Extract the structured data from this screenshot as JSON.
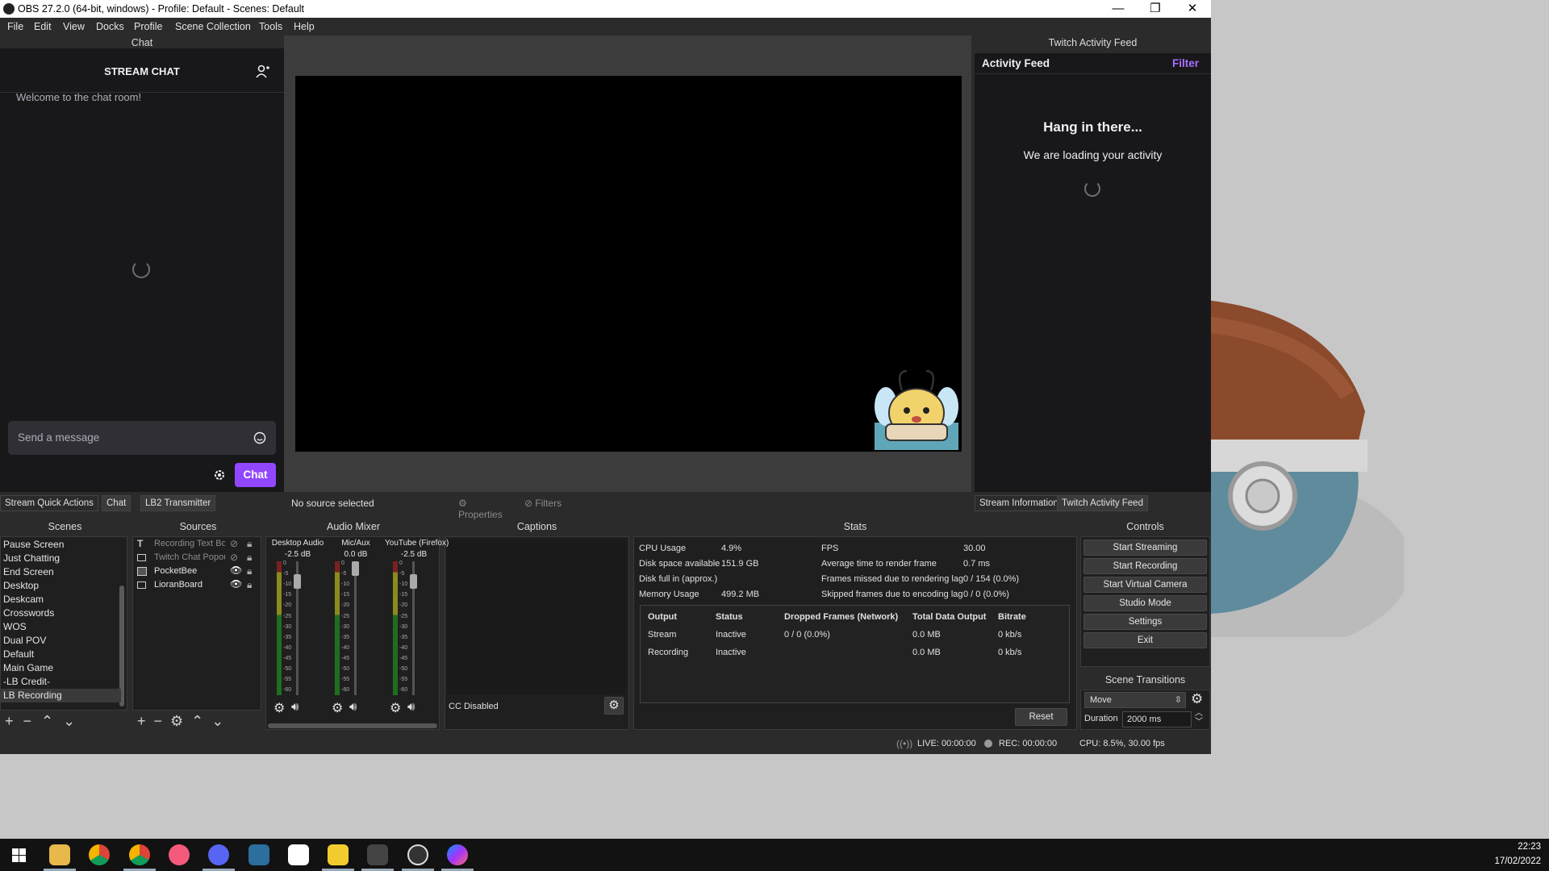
{
  "window": {
    "title": "OBS 27.2.0 (64-bit, windows) - Profile: Default - Scenes: Default",
    "min": "—",
    "max": "❐",
    "close": "✕"
  },
  "menu": [
    "File",
    "Edit",
    "View",
    "Docks",
    "Profile",
    "Scene Collection",
    "Tools",
    "Help"
  ],
  "chat": {
    "dock_title": "Chat",
    "header": "STREAM CHAT",
    "welcome": "Welcome to the chat room!",
    "placeholder": "Send a message",
    "button": "Chat"
  },
  "activity": {
    "dock_title": "Twitch Activity Feed",
    "header": "Activity Feed",
    "filter": "Filter",
    "loading_title": "Hang in there...",
    "loading_sub": "We are loading your activity"
  },
  "tabs_left": [
    "Stream Quick Actions",
    "Chat",
    "LB2 Transmitter"
  ],
  "tabs_right": [
    "Stream Information",
    "Twitch Activity Feed"
  ],
  "source_bar": {
    "status": "No source selected",
    "properties": "Properties",
    "filters": "Filters"
  },
  "scenes": {
    "title": "Scenes",
    "items": [
      "Pause Screen",
      "Just Chatting",
      "End Screen",
      "Desktop",
      "Deskcam",
      "Crosswords",
      "WOS",
      "Dual POV",
      "Default",
      "Main Game",
      "-LB Credit-",
      "LB Recording"
    ],
    "selected": "LB Recording"
  },
  "sources": {
    "title": "Sources",
    "items": [
      "Recording Text Bo",
      "Twitch Chat Popou",
      "PocketBee",
      "LioranBoard"
    ]
  },
  "mixer": {
    "title": "Audio Mixer",
    "channels": [
      {
        "name": "Desktop Audio",
        "db": "-2.5 dB"
      },
      {
        "name": "Mic/Aux",
        "db": "0.0 dB"
      },
      {
        "name": "YouTube (Firefox)",
        "db": "-2.5 dB"
      }
    ],
    "scale": [
      "0",
      "-5",
      "-10",
      "-15",
      "-20",
      "-25",
      "-30",
      "-35",
      "-40",
      "-45",
      "-50",
      "-55",
      "-60"
    ]
  },
  "captions": {
    "title": "Captions",
    "status": "CC Disabled"
  },
  "stats": {
    "title": "Stats",
    "left": [
      [
        "CPU Usage",
        "4.9%"
      ],
      [
        "Disk space available",
        "151.9 GB"
      ],
      [
        "Disk full in (approx.)",
        ""
      ],
      [
        "Memory Usage",
        "499.2 MB"
      ]
    ],
    "right": [
      [
        "FPS",
        "30.00"
      ],
      [
        "Average time to render frame",
        "0.7 ms"
      ],
      [
        "Frames missed due to rendering lag",
        "0 / 154 (0.0%)"
      ],
      [
        "Skipped frames due to encoding lag",
        "0 / 0 (0.0%)"
      ]
    ],
    "table_headers": [
      "Output",
      "Status",
      "Dropped Frames (Network)",
      "Total Data Output",
      "Bitrate"
    ],
    "rows": [
      [
        "Stream",
        "Inactive",
        "0 / 0 (0.0%)",
        "0.0 MB",
        "0 kb/s"
      ],
      [
        "Recording",
        "Inactive",
        "",
        "0.0 MB",
        "0 kb/s"
      ]
    ],
    "reset": "Reset"
  },
  "controls": {
    "title": "Controls",
    "buttons": [
      "Start Streaming",
      "Start Recording",
      "Start Virtual Camera",
      "Studio Mode",
      "Settings",
      "Exit"
    ]
  },
  "transitions": {
    "title": "Scene Transitions",
    "selected": "Move",
    "duration_label": "Duration",
    "duration": "2000 ms"
  },
  "statusbar": {
    "live": "LIVE: 00:00:00",
    "rec": "REC: 00:00:00",
    "cpu": "CPU: 8.5%, 30.00 fps"
  },
  "clock": {
    "time": "22:23",
    "date": "17/02/2022"
  }
}
